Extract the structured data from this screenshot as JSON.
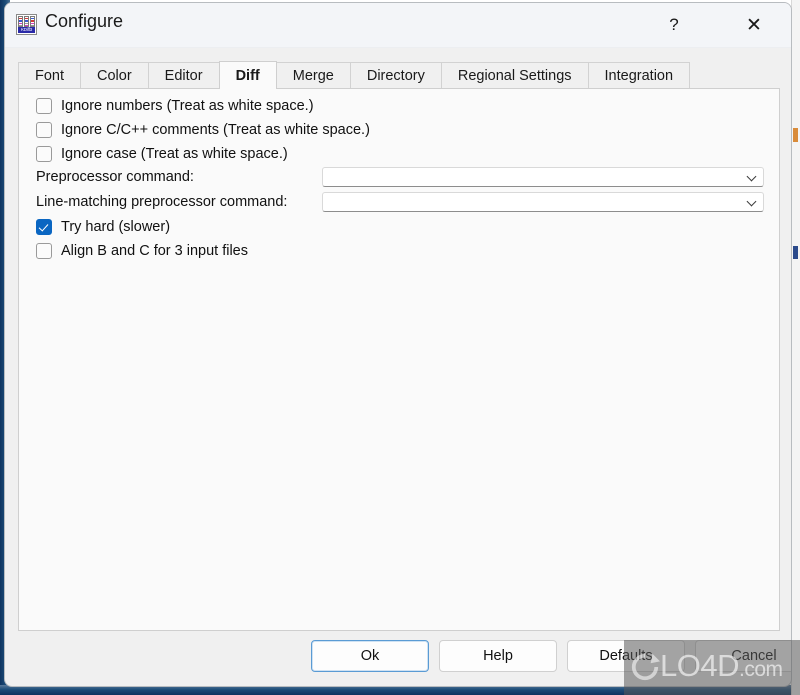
{
  "window": {
    "title": "Configure",
    "icon_name": "kdiff3-icon",
    "icon_label": "KDiff3",
    "help_button": "?",
    "close_button": "✕"
  },
  "tabs": [
    {
      "label": "Font",
      "active": false
    },
    {
      "label": "Color",
      "active": false
    },
    {
      "label": "Editor",
      "active": false
    },
    {
      "label": "Diff",
      "active": true
    },
    {
      "label": "Merge",
      "active": false
    },
    {
      "label": "Directory",
      "active": false
    },
    {
      "label": "Regional Settings",
      "active": false
    },
    {
      "label": "Integration",
      "active": false
    }
  ],
  "diff_panel": {
    "checkboxes_top": [
      {
        "label": "Ignore numbers (Treat as white space.)",
        "checked": false,
        "name": "ignore-numbers"
      },
      {
        "label": "Ignore C/C++ comments (Treat as white space.)",
        "checked": false,
        "name": "ignore-cpp-comments"
      },
      {
        "label": "Ignore case (Treat as white space.)",
        "checked": false,
        "name": "ignore-case"
      }
    ],
    "combos": [
      {
        "label": "Preprocessor command:",
        "value": "",
        "name": "preprocessor-command"
      },
      {
        "label": "Line-matching preprocessor command:",
        "value": "",
        "name": "line-matching-preprocessor-command"
      }
    ],
    "checkboxes_bottom": [
      {
        "label": "Try hard (slower)",
        "checked": true,
        "name": "try-hard"
      },
      {
        "label": "Align B and C for 3 input files",
        "checked": false,
        "name": "align-b-and-c"
      }
    ]
  },
  "buttons": {
    "ok": "Ok",
    "help": "Help",
    "defaults": "Defaults",
    "cancel": "Cancel"
  },
  "watermark": {
    "text": "LO4D",
    "suffix": ".com"
  },
  "colors": {
    "accent": "#0a66c2",
    "focus_border": "#5a9bd4",
    "panel_bg": "#fafafa",
    "dialog_bg": "#f0f0f0",
    "titlebar_bg": "#f3f5f8",
    "text": "#111111"
  }
}
